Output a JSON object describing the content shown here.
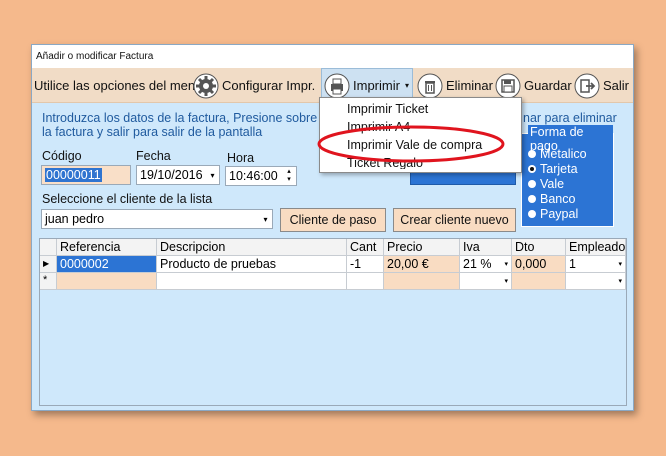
{
  "window": {
    "title": "Añadir o modificar Factura"
  },
  "toolbar": {
    "hint": "Utilice las opciones del menu",
    "configurar_label": "Configurar Impr.",
    "imprimir_label": "Imprimir",
    "eliminar_label": "Eliminar",
    "guardar_label": "Guardar",
    "salir_label": "Salir"
  },
  "info": {
    "line1": "Introduzca los datos de la factura, Presione sobre gu",
    "line1_right": "nar para eliminar",
    "line2": "la factura y salir para salir de la pantalla"
  },
  "form": {
    "codigo_label": "Código",
    "codigo_value": "00000011",
    "fecha_label": "Fecha",
    "fecha_value": "19/10/2016",
    "hora_label": "Hora",
    "hora_value": "10:46:00",
    "cliente_label": "Seleccione el cliente de la lista",
    "cliente_value": "juan pedro",
    "cliente_paso_button": "Cliente de paso",
    "crear_cliente_button": "Crear cliente nuevo"
  },
  "pago": {
    "title": "Forma de pago",
    "options": [
      "Metalico",
      "Tarjeta",
      "Vale",
      "Banco",
      "Paypal"
    ],
    "selected": "Tarjeta"
  },
  "print_menu": {
    "items": [
      "Imprimir Ticket",
      "Imprimir A4",
      "Imprimir Vale de compra",
      "Ticket Regalo"
    ],
    "highlight_color": "#e0141e"
  },
  "grid": {
    "columns": [
      "Referencia",
      "Descripcion",
      "Cant",
      "Precio",
      "Iva",
      "Dto",
      "Empleado"
    ],
    "rows": [
      {
        "referencia": "0000002",
        "descripcion": "Producto de pruebas",
        "cant": "-1",
        "precio": "20,00 €",
        "iva": "21 %",
        "dto": "0,000",
        "empleado": "1"
      }
    ],
    "new_row_marker": "*"
  },
  "colors": {
    "background": "#f5b98c",
    "window": "#cfe8fb",
    "toolbar": "#f1dcc6",
    "accent_blue": "#2c74d4",
    "info_text": "#1f5a9e",
    "peach_cell": "#f9dcc2"
  }
}
